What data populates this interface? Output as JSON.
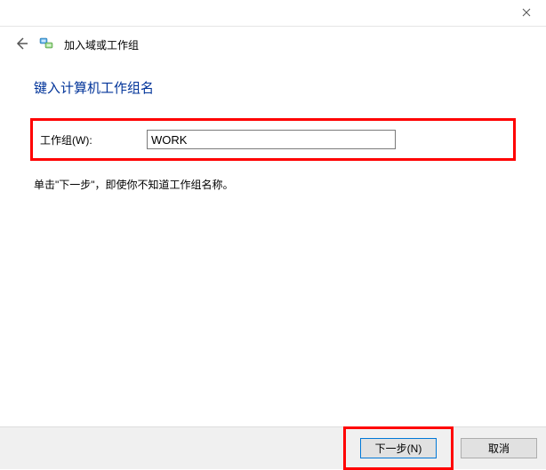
{
  "titlebar": {
    "close_tooltip": "Close"
  },
  "header": {
    "title": "加入域或工作组"
  },
  "content": {
    "heading": "键入计算机工作组名",
    "workgroup_label": "工作组(W):",
    "workgroup_value": "WORK",
    "hint": "单击\"下一步\"，即使你不知道工作组名称。"
  },
  "footer": {
    "next_label": "下一步(N)",
    "cancel_label": "取消"
  }
}
